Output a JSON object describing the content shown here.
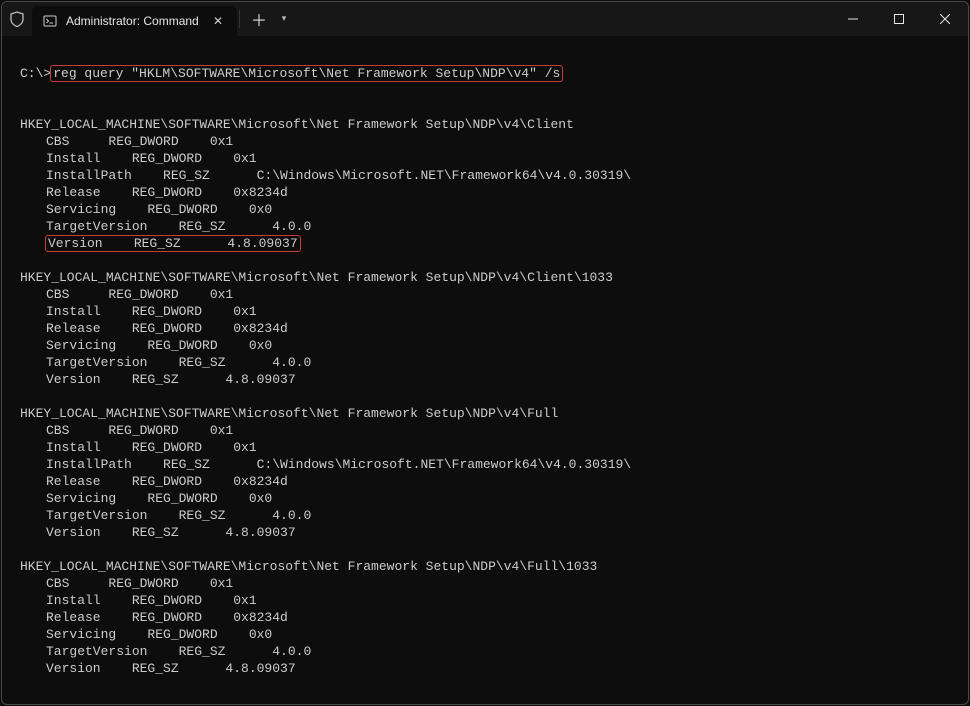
{
  "window": {
    "tab_title": "Administrator: Command Prompt"
  },
  "highlight_colors": {
    "box": "#cc3a3a"
  },
  "prompt": {
    "prefix": "C:\\>",
    "command": "reg query \"HKLM\\SOFTWARE\\Microsoft\\Net Framework Setup\\NDP\\v4\" /s"
  },
  "keys": [
    {
      "path": "HKEY_LOCAL_MACHINE\\SOFTWARE\\Microsoft\\Net Framework Setup\\NDP\\v4\\Client",
      "values": [
        {
          "name": "CBS",
          "type": "REG_DWORD",
          "data": "0x1"
        },
        {
          "name": "Install",
          "type": "REG_DWORD",
          "data": "0x1"
        },
        {
          "name": "InstallPath",
          "type": "REG_SZ",
          "data": "C:\\Windows\\Microsoft.NET\\Framework64\\v4.0.30319\\"
        },
        {
          "name": "Release",
          "type": "REG_DWORD",
          "data": "0x8234d"
        },
        {
          "name": "Servicing",
          "type": "REG_DWORD",
          "data": "0x0"
        },
        {
          "name": "TargetVersion",
          "type": "REG_SZ",
          "data": "4.0.0"
        },
        {
          "name": "Version",
          "type": "REG_SZ",
          "data": "4.8.09037",
          "highlight": true
        }
      ]
    },
    {
      "path": "HKEY_LOCAL_MACHINE\\SOFTWARE\\Microsoft\\Net Framework Setup\\NDP\\v4\\Client\\1033",
      "values": [
        {
          "name": "CBS",
          "type": "REG_DWORD",
          "data": "0x1"
        },
        {
          "name": "Install",
          "type": "REG_DWORD",
          "data": "0x1"
        },
        {
          "name": "Release",
          "type": "REG_DWORD",
          "data": "0x8234d"
        },
        {
          "name": "Servicing",
          "type": "REG_DWORD",
          "data": "0x0"
        },
        {
          "name": "TargetVersion",
          "type": "REG_SZ",
          "data": "4.0.0"
        },
        {
          "name": "Version",
          "type": "REG_SZ",
          "data": "4.8.09037"
        }
      ]
    },
    {
      "path": "HKEY_LOCAL_MACHINE\\SOFTWARE\\Microsoft\\Net Framework Setup\\NDP\\v4\\Full",
      "values": [
        {
          "name": "CBS",
          "type": "REG_DWORD",
          "data": "0x1"
        },
        {
          "name": "Install",
          "type": "REG_DWORD",
          "data": "0x1"
        },
        {
          "name": "InstallPath",
          "type": "REG_SZ",
          "data": "C:\\Windows\\Microsoft.NET\\Framework64\\v4.0.30319\\"
        },
        {
          "name": "Release",
          "type": "REG_DWORD",
          "data": "0x8234d"
        },
        {
          "name": "Servicing",
          "type": "REG_DWORD",
          "data": "0x0"
        },
        {
          "name": "TargetVersion",
          "type": "REG_SZ",
          "data": "4.0.0"
        },
        {
          "name": "Version",
          "type": "REG_SZ",
          "data": "4.8.09037"
        }
      ]
    },
    {
      "path": "HKEY_LOCAL_MACHINE\\SOFTWARE\\Microsoft\\Net Framework Setup\\NDP\\v4\\Full\\1033",
      "values": [
        {
          "name": "CBS",
          "type": "REG_DWORD",
          "data": "0x1"
        },
        {
          "name": "Install",
          "type": "REG_DWORD",
          "data": "0x1"
        },
        {
          "name": "Release",
          "type": "REG_DWORD",
          "data": "0x8234d"
        },
        {
          "name": "Servicing",
          "type": "REG_DWORD",
          "data": "0x0"
        },
        {
          "name": "TargetVersion",
          "type": "REG_SZ",
          "data": "4.0.0"
        },
        {
          "name": "Version",
          "type": "REG_SZ",
          "data": "4.8.09037"
        }
      ]
    }
  ]
}
